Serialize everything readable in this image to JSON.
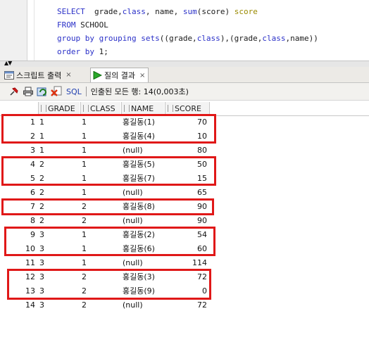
{
  "editor": {
    "lines": [
      {
        "parts": [
          {
            "t": "SELECT",
            "c": "kw"
          },
          {
            "t": "  grade,",
            "c": "tx"
          },
          {
            "t": "class",
            "c": "kw"
          },
          {
            "t": ", name, ",
            "c": "tx"
          },
          {
            "t": "sum",
            "c": "fn"
          },
          {
            "t": "(score) ",
            "c": "tx"
          },
          {
            "t": "score",
            "c": "hl"
          }
        ]
      },
      {
        "parts": [
          {
            "t": "FROM",
            "c": "kw"
          },
          {
            "t": " SCHOOL",
            "c": "tx"
          }
        ]
      },
      {
        "parts": [
          {
            "t": "group by grouping sets",
            "c": "kw"
          },
          {
            "t": "((grade,",
            "c": "tx"
          },
          {
            "t": "class",
            "c": "kw"
          },
          {
            "t": "),(grade,",
            "c": "tx"
          },
          {
            "t": "class",
            "c": "kw"
          },
          {
            "t": ",name))",
            "c": "tx"
          }
        ]
      },
      {
        "parts": [
          {
            "t": "order by",
            "c": "kw"
          },
          {
            "t": " 1;",
            "c": "tx"
          }
        ]
      }
    ]
  },
  "tabs": [
    {
      "label": "스크립트 출력",
      "icon": "script-output-icon",
      "close": "×"
    },
    {
      "label": "질의 결과",
      "icon": "run-triangle-icon",
      "close": "×"
    }
  ],
  "toolbar": {
    "sql_label": "SQL",
    "status": "인출된 모든 행: 14(0,003초)"
  },
  "grid": {
    "columns": [
      "GRADE",
      "CLASS",
      "NAME",
      "SCORE"
    ],
    "rows": [
      {
        "n": "1",
        "grade": "1",
        "class": "1",
        "name": "홍길동(1)",
        "score": "70"
      },
      {
        "n": "2",
        "grade": "1",
        "class": "1",
        "name": "홍길동(4)",
        "score": "10"
      },
      {
        "n": "3",
        "grade": "1",
        "class": "1",
        "name": "(null)",
        "score": "80"
      },
      {
        "n": "4",
        "grade": "2",
        "class": "1",
        "name": "홍길동(5)",
        "score": "50"
      },
      {
        "n": "5",
        "grade": "2",
        "class": "1",
        "name": "홍길동(7)",
        "score": "15"
      },
      {
        "n": "6",
        "grade": "2",
        "class": "1",
        "name": "(null)",
        "score": "65"
      },
      {
        "n": "7",
        "grade": "2",
        "class": "2",
        "name": "홍길동(8)",
        "score": "90"
      },
      {
        "n": "8",
        "grade": "2",
        "class": "2",
        "name": "(null)",
        "score": "90"
      },
      {
        "n": "9",
        "grade": "3",
        "class": "1",
        "name": "홍길동(2)",
        "score": "54"
      },
      {
        "n": "10",
        "grade": "3",
        "class": "1",
        "name": "홍길동(6)",
        "score": "60"
      },
      {
        "n": "11",
        "grade": "3",
        "class": "1",
        "name": "(null)",
        "score": "114"
      },
      {
        "n": "12",
        "grade": "3",
        "class": "2",
        "name": "홍길동(3)",
        "score": "72"
      },
      {
        "n": "13",
        "grade": "3",
        "class": "2",
        "name": "홍길동(9)",
        "score": "0"
      },
      {
        "n": "14",
        "grade": "3",
        "class": "2",
        "name": "(null)",
        "score": "72"
      }
    ]
  },
  "colors": {
    "keyword": "#2a30c8",
    "alias": "#9a8a00",
    "highlight_box": "#e01818",
    "sql_label": "#1f3fb0"
  }
}
